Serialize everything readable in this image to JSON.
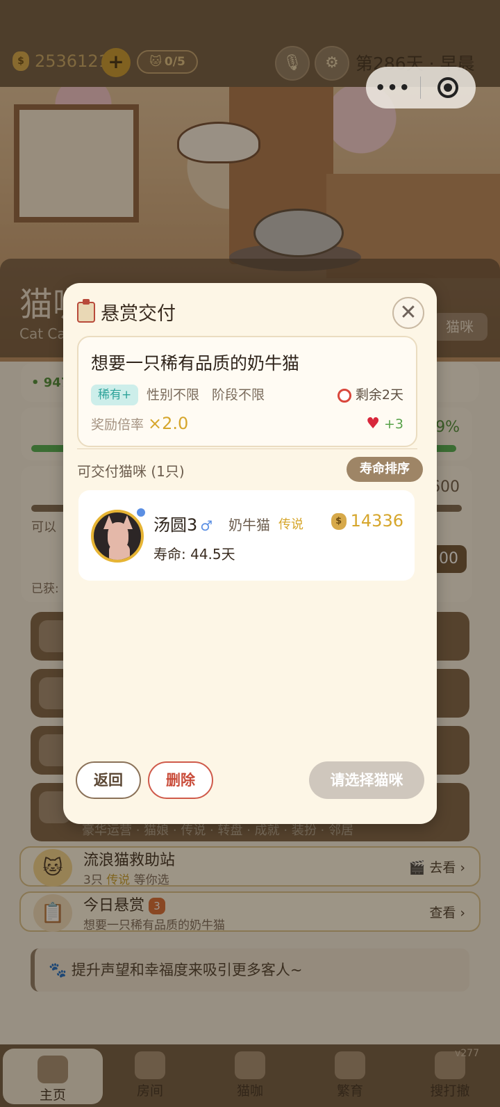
{
  "header": {
    "coins": "2536121",
    "plus_label": "+",
    "cat_count": "0/5",
    "day_text": "第286天 · 早晨",
    "capsule_more": "•••"
  },
  "shop": {
    "title": "猫咖",
    "subtitle": "Cat Ca",
    "cat_button": "猫咪",
    "stat_value": "947",
    "happiness_pct": "99%",
    "star_value": "600",
    "row_label": "可以",
    "side_number": "00",
    "earned_label": "已获:",
    "extra_line": "豪华运营 · 猫娘 · 传说 · 转盘 · 成就 · 装扮 · 邻居"
  },
  "entries": [
    {
      "title": "流浪猫救助站",
      "sub_prefix": "3只",
      "sub_legend": "传说",
      "sub_suffix": "等你选",
      "action": "去看 ›"
    },
    {
      "title": "今日悬赏",
      "badge": "3",
      "sub": "想要一只稀有品质的奶牛猫",
      "action": "查看 ›"
    }
  ],
  "tip": "提升声望和幸福度来吸引更多客人~",
  "tabs": [
    {
      "label": "主页"
    },
    {
      "label": "房间"
    },
    {
      "label": "猫咖"
    },
    {
      "label": "繁育"
    },
    {
      "label": "搜打撤"
    }
  ],
  "version": "v277",
  "modal": {
    "title": "悬赏交付",
    "close": "✕",
    "request": {
      "title": "想要一只稀有品质的奶牛猫",
      "rarity_tag": "稀有+",
      "gender": "性别不限",
      "stage": "阶段不限",
      "remaining": "剩余2天",
      "reward_label": "奖励倍率",
      "reward_multiplier": "×2.0",
      "heart_bonus": "+3"
    },
    "available_label": "可交付猫咪 (1只)",
    "sort_button": "寿命排序",
    "cat": {
      "name": "汤圆3",
      "gender_symbol": "♂",
      "breed": "奶牛猫",
      "quality": "传说",
      "price": "14336",
      "lifespan": "寿命: 44.5天"
    },
    "back_button": "返回",
    "delete_button": "删除",
    "choose_button": "请选择猫咪"
  }
}
